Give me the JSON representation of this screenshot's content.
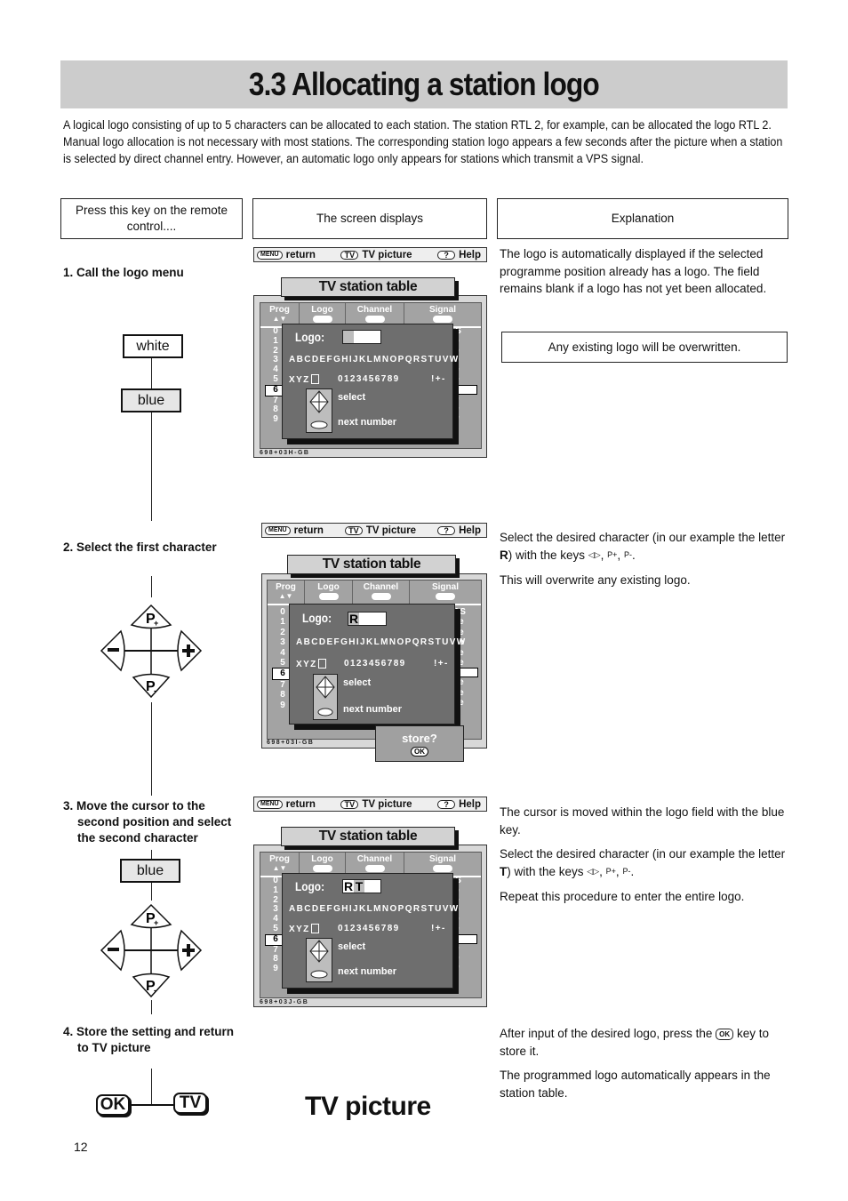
{
  "page": {
    "title": "3.3 Allocating a station logo",
    "intro": [
      "A logical logo consisting of up to 5 characters can be allocated to each station. The station RTL 2, for example, can be allocated the logo RTL 2.",
      "Manual logo allocation is not necessary with most stations. The corresponding station logo appears a few seconds after the picture when a station is selected by direct channel entry. However, an automatic logo only appears for stations which transmit a VPS signal."
    ],
    "page_number": "12"
  },
  "columns": {
    "remote": "Press this key on the remote control....",
    "screen": "The screen displays",
    "explanation": "Explanation"
  },
  "steps": [
    {
      "title": "1. Call the logo menu",
      "keys": [
        "white",
        "blue"
      ],
      "explanation": "The logo is automatically displayed if the selected programme position already has a logo. The field remains blank if a logo has not yet been allocated.",
      "note_box": "Any existing logo will be overwritten.",
      "screen_code": "698+03H-GB",
      "logo_value": [
        "",
        "",
        "",
        "",
        ""
      ]
    },
    {
      "title": "2. Select the first character",
      "keys": [
        "P+",
        "-",
        "+",
        "P-"
      ],
      "explanation_line1": "Select the desired character (in our example the letter",
      "explanation_bold": "R",
      "explanation_line2": ") with the keys",
      "explanation2": "This will overwrite any existing logo.",
      "screen_code": "698+03I-GB",
      "logo_value": [
        "R",
        "",
        "",
        "",
        ""
      ],
      "store_prompt": "store?",
      "store_key": "OK"
    },
    {
      "title_lines": [
        "3. Move the cursor to the",
        "second position and select",
        "the second character"
      ],
      "keys": [
        "blue",
        "P+",
        "-",
        "+",
        "P-"
      ],
      "explanation1": "The cursor is moved within the logo field with the blue key.",
      "explanation_line1": "Select the desired character (in our example the letter",
      "explanation_bold": "T",
      "explanation_line2": ") with the keys",
      "explanation3": "Repeat this procedure to enter the entire logo.",
      "screen_code": "698+03J-GB",
      "logo_value": [
        "R",
        "T",
        "",
        "",
        ""
      ]
    },
    {
      "title_lines": [
        "4. Store the setting and return",
        "to TV picture"
      ],
      "keys": [
        "OK",
        "TV"
      ],
      "screen_text": "TV picture",
      "explanation_a": "After input of the desired logo, press the",
      "explanation_key": "OK",
      "explanation_b": "key to store it.",
      "explanation2": "The programmed logo automatically appears in the station table."
    }
  ],
  "tv_menu": {
    "topbar": {
      "menu_key": "MENU",
      "return_label": "return",
      "tv_key": "TV",
      "tv_label": "TV picture",
      "help_key": "?",
      "help_label": "Help"
    },
    "table_title": "TV station table",
    "column_headers": [
      "Prog",
      "Logo",
      "Channel",
      "Signal"
    ],
    "prog_arrows": "▲▼",
    "prog_numbers": [
      "0",
      "1",
      "2",
      "3",
      "4",
      "5",
      "6",
      "7",
      "8",
      "9"
    ],
    "selected_prog": "6",
    "signal_values": [
      "AS",
      "ne",
      "ne",
      "ne",
      "ne",
      "ne",
      "",
      "ne",
      "ne",
      "ne"
    ],
    "logo_label": "Logo:",
    "alphabet_row": "ABCDEFGHIJKLMNOPQRSTUVW",
    "row2_letters": "XYZ",
    "row2_digits": "0123456789",
    "row2_symbols": "!+-",
    "select_label": "select",
    "next_label": "next number"
  },
  "inline_keys": {
    "left_right": "◁▷",
    "p_plus": "P+",
    "p_minus": "P-"
  }
}
